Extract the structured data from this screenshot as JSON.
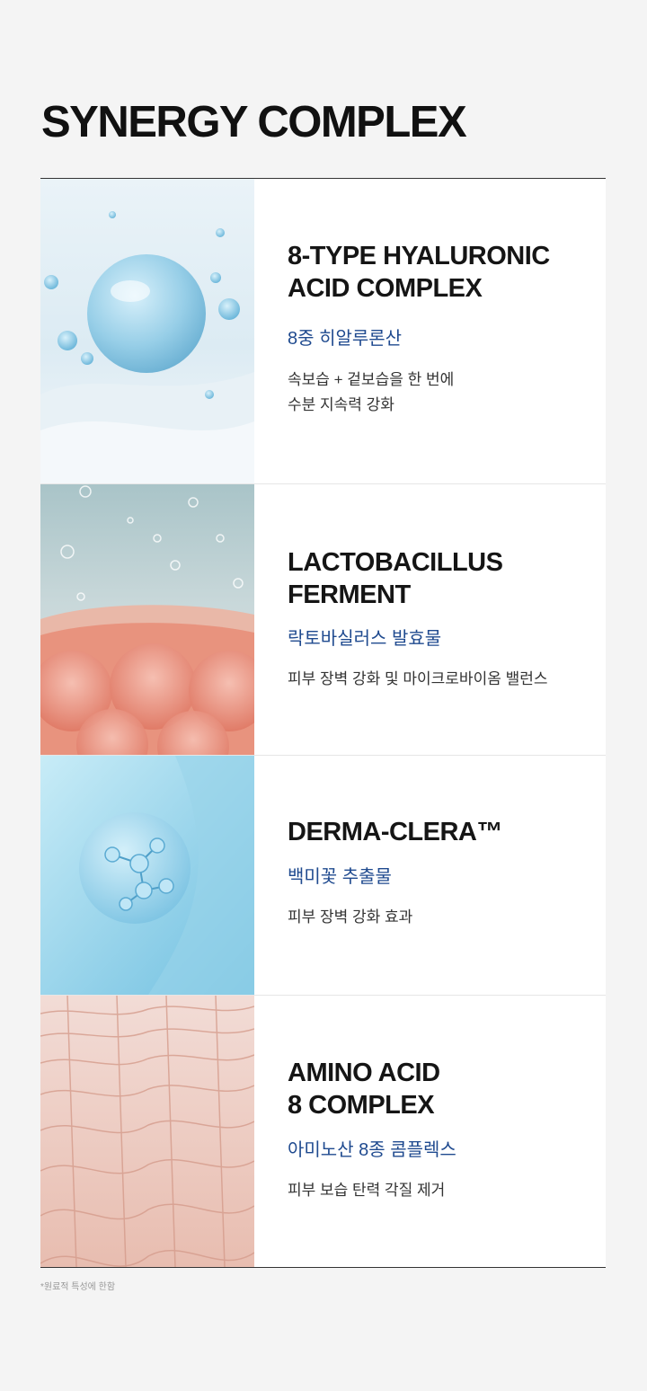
{
  "page": {
    "title": "SYNERGY COMPLEX",
    "footnote": "*원료적 특성에 한함",
    "colors": {
      "background": "#f4f4f4",
      "korean_accent": "#1f4a8f",
      "title": "#111111"
    }
  },
  "items": [
    {
      "english_name": "8-TYPE HYALURONIC\nACID COMPLEX",
      "korean_name": "8중 히알루론산",
      "description": "속보습 + 겉보습을 한 번에\n수분 지속력 강화",
      "image": "water-bubble-image"
    },
    {
      "english_name": "LACTOBACILLUS\nFERMENT",
      "korean_name": "락토바실러스 발효물",
      "description": "피부 장벽 강화 및 마이크로바이옴 밸런스",
      "image": "cell-bubbles-image"
    },
    {
      "english_name": "DERMA-CLERA™",
      "korean_name": "백미꽃 추출물",
      "description": "피부 장벽 강화 효과",
      "image": "molecule-sphere-image"
    },
    {
      "english_name": "AMINO ACID\n8 COMPLEX",
      "korean_name": "아미노산 8종 콤플렉스",
      "description": "피부 보습 탄력 각질 제거",
      "image": "skin-texture-image"
    }
  ]
}
